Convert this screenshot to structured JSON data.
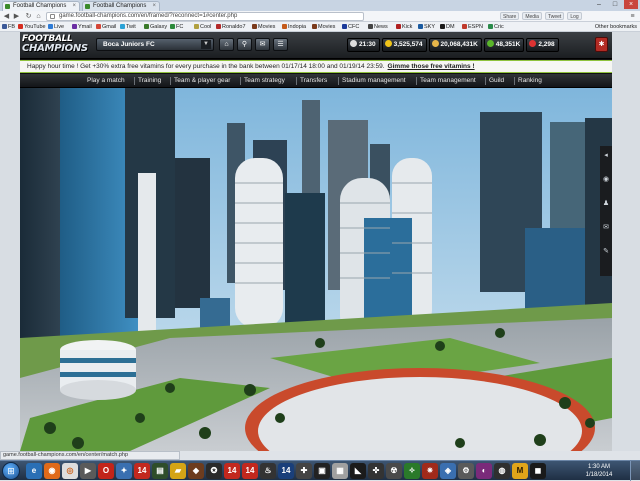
{
  "browser": {
    "tabs": [
      {
        "label": "Football Champions"
      },
      {
        "label": "Football Champions"
      }
    ],
    "url": "game.football-champions.com/en/framed/?reconnect=1#center.php",
    "extensions": [
      "Share",
      "Media",
      "Tweet",
      "Log"
    ],
    "bookmarks": [
      {
        "label": "FB",
        "color": "#3b5998"
      },
      {
        "label": "YouTube",
        "color": "#d62d20"
      },
      {
        "label": "Live",
        "color": "#2e7bd6"
      },
      {
        "label": "Ymail",
        "color": "#6b2ea3"
      },
      {
        "label": "Gmail",
        "color": "#d44638"
      },
      {
        "label": "Twit",
        "color": "#2ba2d6"
      },
      {
        "label": "Galaxy",
        "color": "#3a7a2a"
      },
      {
        "label": "FC",
        "color": "#2c8a3b"
      },
      {
        "label": "Cool",
        "color": "#b0a040"
      },
      {
        "label": "Ronaldo7",
        "color": "#b32a2a"
      },
      {
        "label": "Movies",
        "color": "#7a3a1a"
      },
      {
        "label": "Indopia",
        "color": "#c45a1a"
      },
      {
        "label": "Movies",
        "color": "#7a3a1a"
      },
      {
        "label": "CFC",
        "color": "#1a3a9a"
      },
      {
        "label": "News",
        "color": "#444444"
      },
      {
        "label": "Kick",
        "color": "#b02020"
      },
      {
        "label": "SKY",
        "color": "#1a5aa0"
      },
      {
        "label": "DM",
        "color": "#1a1a1a"
      },
      {
        "label": "ESPN",
        "color": "#c0392b"
      },
      {
        "label": "Cric",
        "color": "#2a8a4a"
      }
    ],
    "other_bookmarks": "Other bookmarks",
    "status_url": "game.football-champions.com/en/center/match.php"
  },
  "game": {
    "logo_line1": "FOOTBALL",
    "logo_line2": "CHAMPIONS",
    "club": "Boca Juniors FC",
    "header_buttons": [
      {
        "name": "home-icon",
        "glyph": "⌂"
      },
      {
        "name": "search-icon",
        "glyph": "⌕"
      },
      {
        "name": "chat-icon",
        "glyph": "✉"
      },
      {
        "name": "messages-icon",
        "glyph": "☰"
      }
    ],
    "stats": {
      "time": "21:30",
      "stars": "3,525,574",
      "money": "20,068,431K",
      "green": "48,351K",
      "vitamins": "2,298"
    },
    "promo_text": "Happy hour time ! Get +30% extra free vitamins for every purchase in the bank between 01/17/14 18:00 and 01/19/14 23:59.",
    "promo_link": "Gimme those free vitamins !",
    "menu": [
      "Play a match",
      "Training",
      "Team & player gear",
      "Team strategy",
      "Transfers",
      "Stadium management",
      "Team management",
      "Guild",
      "Ranking"
    ],
    "sidebar_icons": [
      "arrow-icon",
      "globe-icon",
      "user-icon",
      "mail-icon",
      "pen-icon"
    ]
  },
  "taskbar": {
    "time": "1:30 AM",
    "date": "1/18/2014"
  }
}
